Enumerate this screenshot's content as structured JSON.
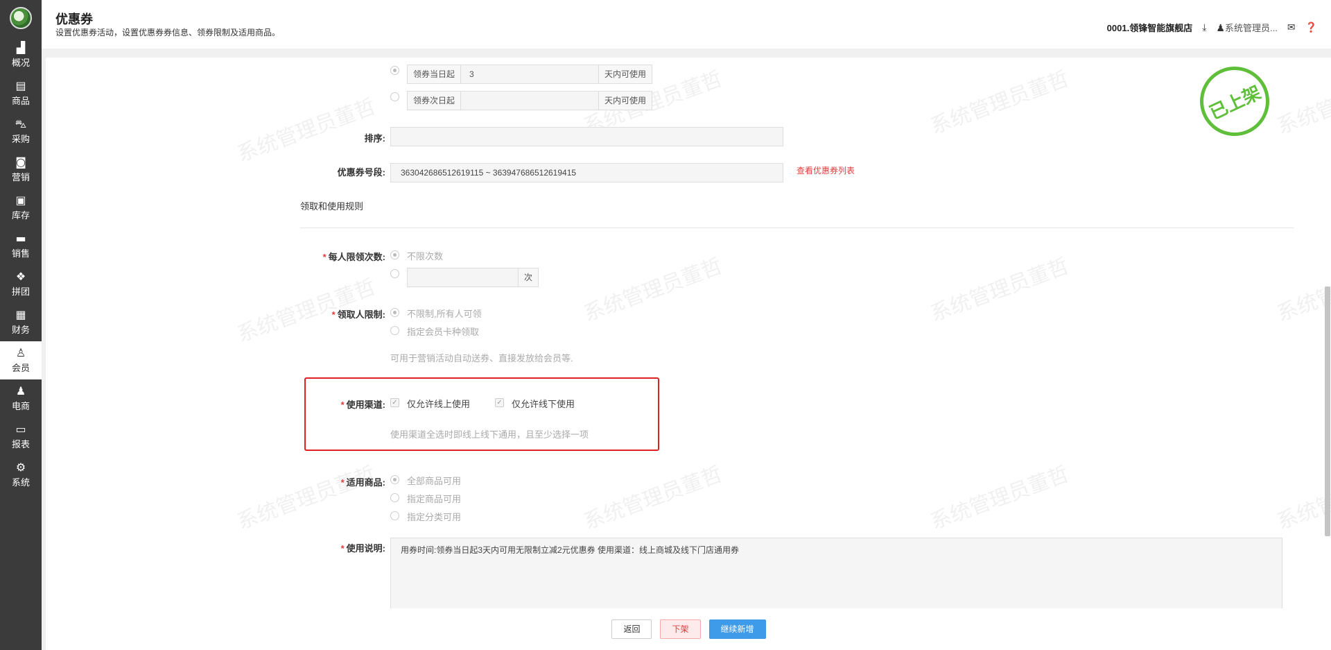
{
  "sidebar": {
    "items": [
      {
        "label": "概况",
        "icon": "building-icon"
      },
      {
        "label": "商品",
        "icon": "document-icon"
      },
      {
        "label": "采购",
        "icon": "cart-icon"
      },
      {
        "label": "营销",
        "icon": "bag-icon"
      },
      {
        "label": "库存",
        "icon": "box-icon"
      },
      {
        "label": "销售",
        "icon": "printer-icon"
      },
      {
        "label": "拼团",
        "icon": "grid-icon"
      },
      {
        "label": "财务",
        "icon": "money-icon"
      },
      {
        "label": "会员",
        "icon": "user-icon"
      },
      {
        "label": "电商",
        "icon": "person-icon"
      },
      {
        "label": "报表",
        "icon": "chart-icon"
      },
      {
        "label": "系统",
        "icon": "gear-icon"
      }
    ],
    "active": "会员"
  },
  "header": {
    "title": "优惠券",
    "subtitle": "设置优惠券活动，设置优惠券券信息、领券限制及适用商品。",
    "store": "0001.领锋智能旗舰店",
    "user": "系统管理员..."
  },
  "watermark": "系统管理员董哲",
  "stamp": "已上架",
  "validity": {
    "opt1_prefix": "领券当日起",
    "opt1_value": "3",
    "opt1_suffix": "天内可使用",
    "opt2_prefix": "领券次日起",
    "opt2_value": "",
    "opt2_suffix": "天内可使用"
  },
  "sort": {
    "label": "排序:",
    "value": ""
  },
  "coupon_range": {
    "label": "优惠券号段:",
    "value": "363042686512619115 ~ 363947686512619415",
    "link": "查看优惠券列表"
  },
  "section_rules": "领取和使用规则",
  "per_person": {
    "label": "每人限领次数:",
    "opt1": "不限次数",
    "unit": "次"
  },
  "receiver": {
    "label": "领取人限制:",
    "opt1": "不限制,所有人可领",
    "opt2": "指定会员卡种领取",
    "hint": "可用于营销活动自动送券、直接发放给会员等."
  },
  "channel": {
    "label": "使用渠道:",
    "opt1": "仅允许线上使用",
    "opt2": "仅允许线下使用",
    "hint": "使用渠道全选时即线上线下通用，且至少选择一项"
  },
  "products": {
    "label": "适用商品:",
    "opt1": "全部商品可用",
    "opt2": "指定商品可用",
    "opt3": "指定分类可用"
  },
  "description": {
    "label": "使用说明:",
    "value": "用券时间:领券当日起3天内可用无限制立减2元优惠券 使用渠道：线上商城及线下门店通用券"
  },
  "footer": {
    "back": "返回",
    "offline": "下架",
    "continue": "继续新增"
  }
}
